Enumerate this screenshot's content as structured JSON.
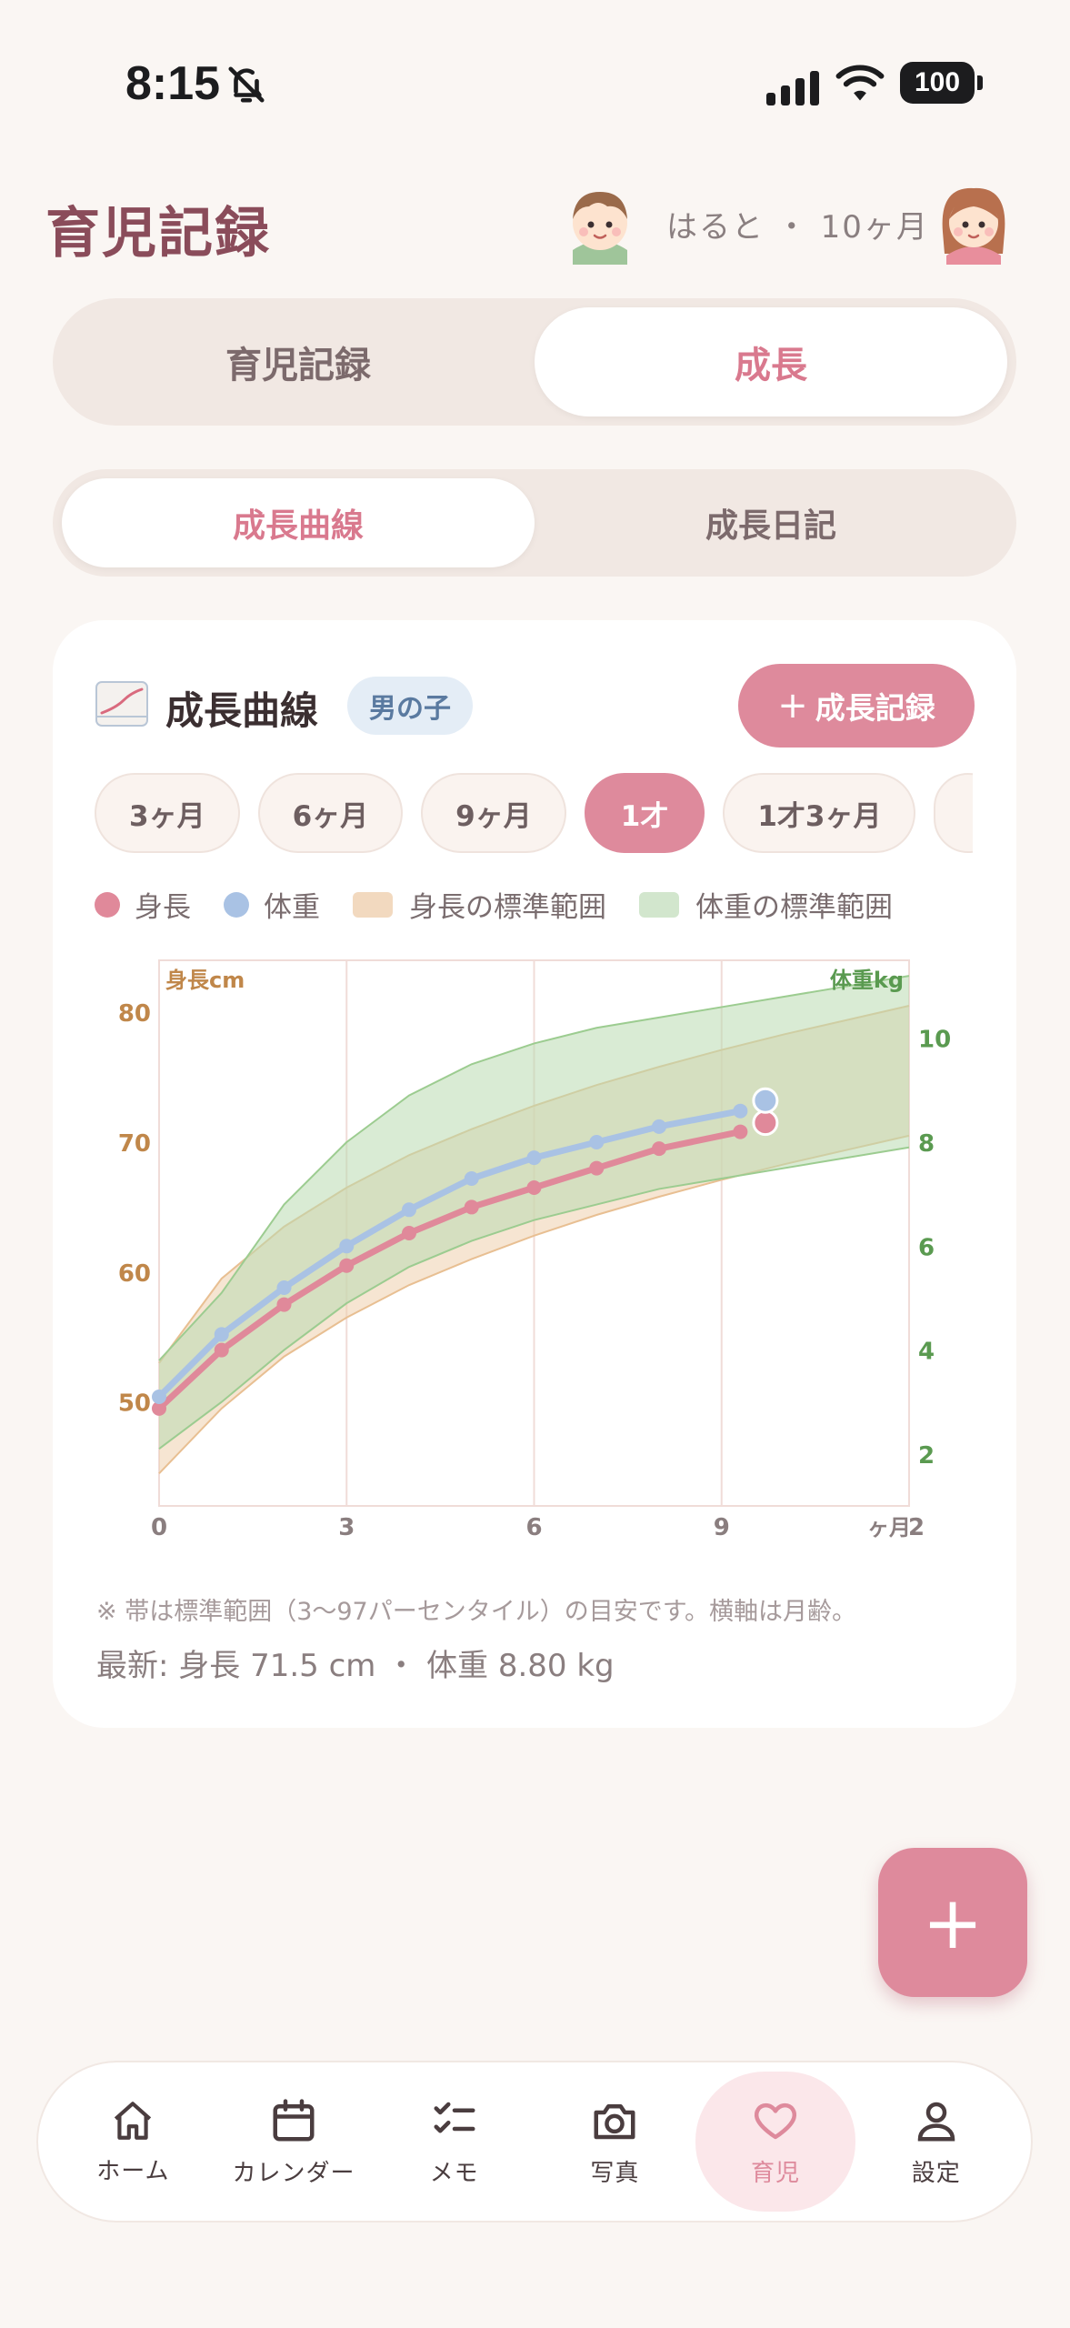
{
  "status_bar": {
    "time": "8:15",
    "battery": "100",
    "icons": [
      "bell-slash-icon",
      "signal-icon",
      "wifi-icon",
      "battery-icon"
    ]
  },
  "header": {
    "title": "育児記録",
    "child_info": "はると ・ 10ヶ月"
  },
  "main_tabs": [
    {
      "label": "育児記録",
      "active": false
    },
    {
      "label": "成長",
      "active": true
    }
  ],
  "sub_tabs": [
    {
      "label": "成長曲線",
      "active": true
    },
    {
      "label": "成長日記",
      "active": false
    }
  ],
  "card": {
    "title": "成長曲線",
    "gender_badge": "男の子",
    "add_button": "成長記録",
    "age_chips": [
      {
        "label": "3ヶ月",
        "active": false
      },
      {
        "label": "6ヶ月",
        "active": false
      },
      {
        "label": "9ヶ月",
        "active": false
      },
      {
        "label": "1才",
        "active": true
      },
      {
        "label": "1才3ヶ月",
        "active": false
      }
    ],
    "legend": [
      {
        "label": "身長",
        "color": "#e0899a"
      },
      {
        "label": "体重",
        "color": "#a9c2e4"
      },
      {
        "label": "身長の標準範囲",
        "color": "#f2d9bf"
      },
      {
        "label": "体重の標準範囲",
        "color": "#d2e6cd"
      }
    ],
    "note": "※ 帯は標準範囲（3〜97パーセンタイル）の目安です。横軸は月齢。",
    "latest": "最新: 身長 71.5 cm ・ 体重 8.80 kg"
  },
  "chart_data": {
    "type": "line",
    "x_unit_label": "ヶ月",
    "x_ticks": [
      "0",
      "3",
      "6",
      "9",
      "2"
    ],
    "xlim": [
      0,
      12
    ],
    "y_left": {
      "label": "身長cm",
      "ticks": [
        50,
        60,
        70,
        80
      ],
      "range": [
        42,
        84
      ],
      "color": "#c0874a"
    },
    "y_right": {
      "label": "体重kg",
      "ticks": [
        2,
        4,
        6,
        8,
        10
      ],
      "range": [
        1,
        11.5
      ],
      "color": "#5a9a50"
    },
    "height_band": {
      "x": [
        0,
        1,
        2,
        3,
        4,
        5,
        6,
        7,
        8,
        9,
        10,
        11,
        12
      ],
      "lower": [
        44.5,
        49.5,
        53.5,
        56.5,
        59.0,
        61.0,
        62.8,
        64.4,
        65.8,
        67.1,
        68.3,
        69.4,
        70.5
      ],
      "upper": [
        53.0,
        59.5,
        63.5,
        66.5,
        69.0,
        71.0,
        72.8,
        74.4,
        75.8,
        77.1,
        78.3,
        79.4,
        80.5
      ],
      "axis": "left"
    },
    "weight_band": {
      "x": [
        0,
        1,
        2,
        3,
        4,
        5,
        6,
        7,
        8,
        9,
        10,
        11,
        12
      ],
      "lower": [
        2.1,
        3.0,
        4.0,
        4.9,
        5.6,
        6.1,
        6.5,
        6.8,
        7.1,
        7.3,
        7.5,
        7.7,
        7.9
      ],
      "upper": [
        3.8,
        5.1,
        6.8,
        8.0,
        8.9,
        9.5,
        9.9,
        10.2,
        10.4,
        10.6,
        10.8,
        11.0,
        11.2
      ],
      "axis": "right"
    },
    "series": [
      {
        "name": "身長",
        "axis": "left",
        "color": "#e0899a",
        "x": [
          0,
          1,
          2,
          3,
          4,
          5,
          6,
          7,
          8,
          9.3,
          9.7
        ],
        "y": [
          49.5,
          54.0,
          57.5,
          60.5,
          63.0,
          65.0,
          66.5,
          68.0,
          69.5,
          70.8,
          71.5
        ]
      },
      {
        "name": "体重",
        "axis": "right",
        "color": "#a9c2e4",
        "x": [
          0,
          1,
          2,
          3,
          4,
          5,
          6,
          7,
          8,
          9.3,
          9.7
        ],
        "y": [
          3.1,
          4.3,
          5.2,
          6.0,
          6.7,
          7.3,
          7.7,
          8.0,
          8.3,
          8.6,
          8.8
        ]
      }
    ]
  },
  "fab": {
    "label": "+"
  },
  "bottom_nav": [
    {
      "label": "ホーム",
      "icon": "home-icon",
      "active": false
    },
    {
      "label": "カレンダー",
      "icon": "calendar-icon",
      "active": false
    },
    {
      "label": "メモ",
      "icon": "checklist-icon",
      "active": false
    },
    {
      "label": "写真",
      "icon": "camera-icon",
      "active": false
    },
    {
      "label": "育児",
      "icon": "heart-icon",
      "active": true
    },
    {
      "label": "設定",
      "icon": "person-icon",
      "active": false
    }
  ]
}
